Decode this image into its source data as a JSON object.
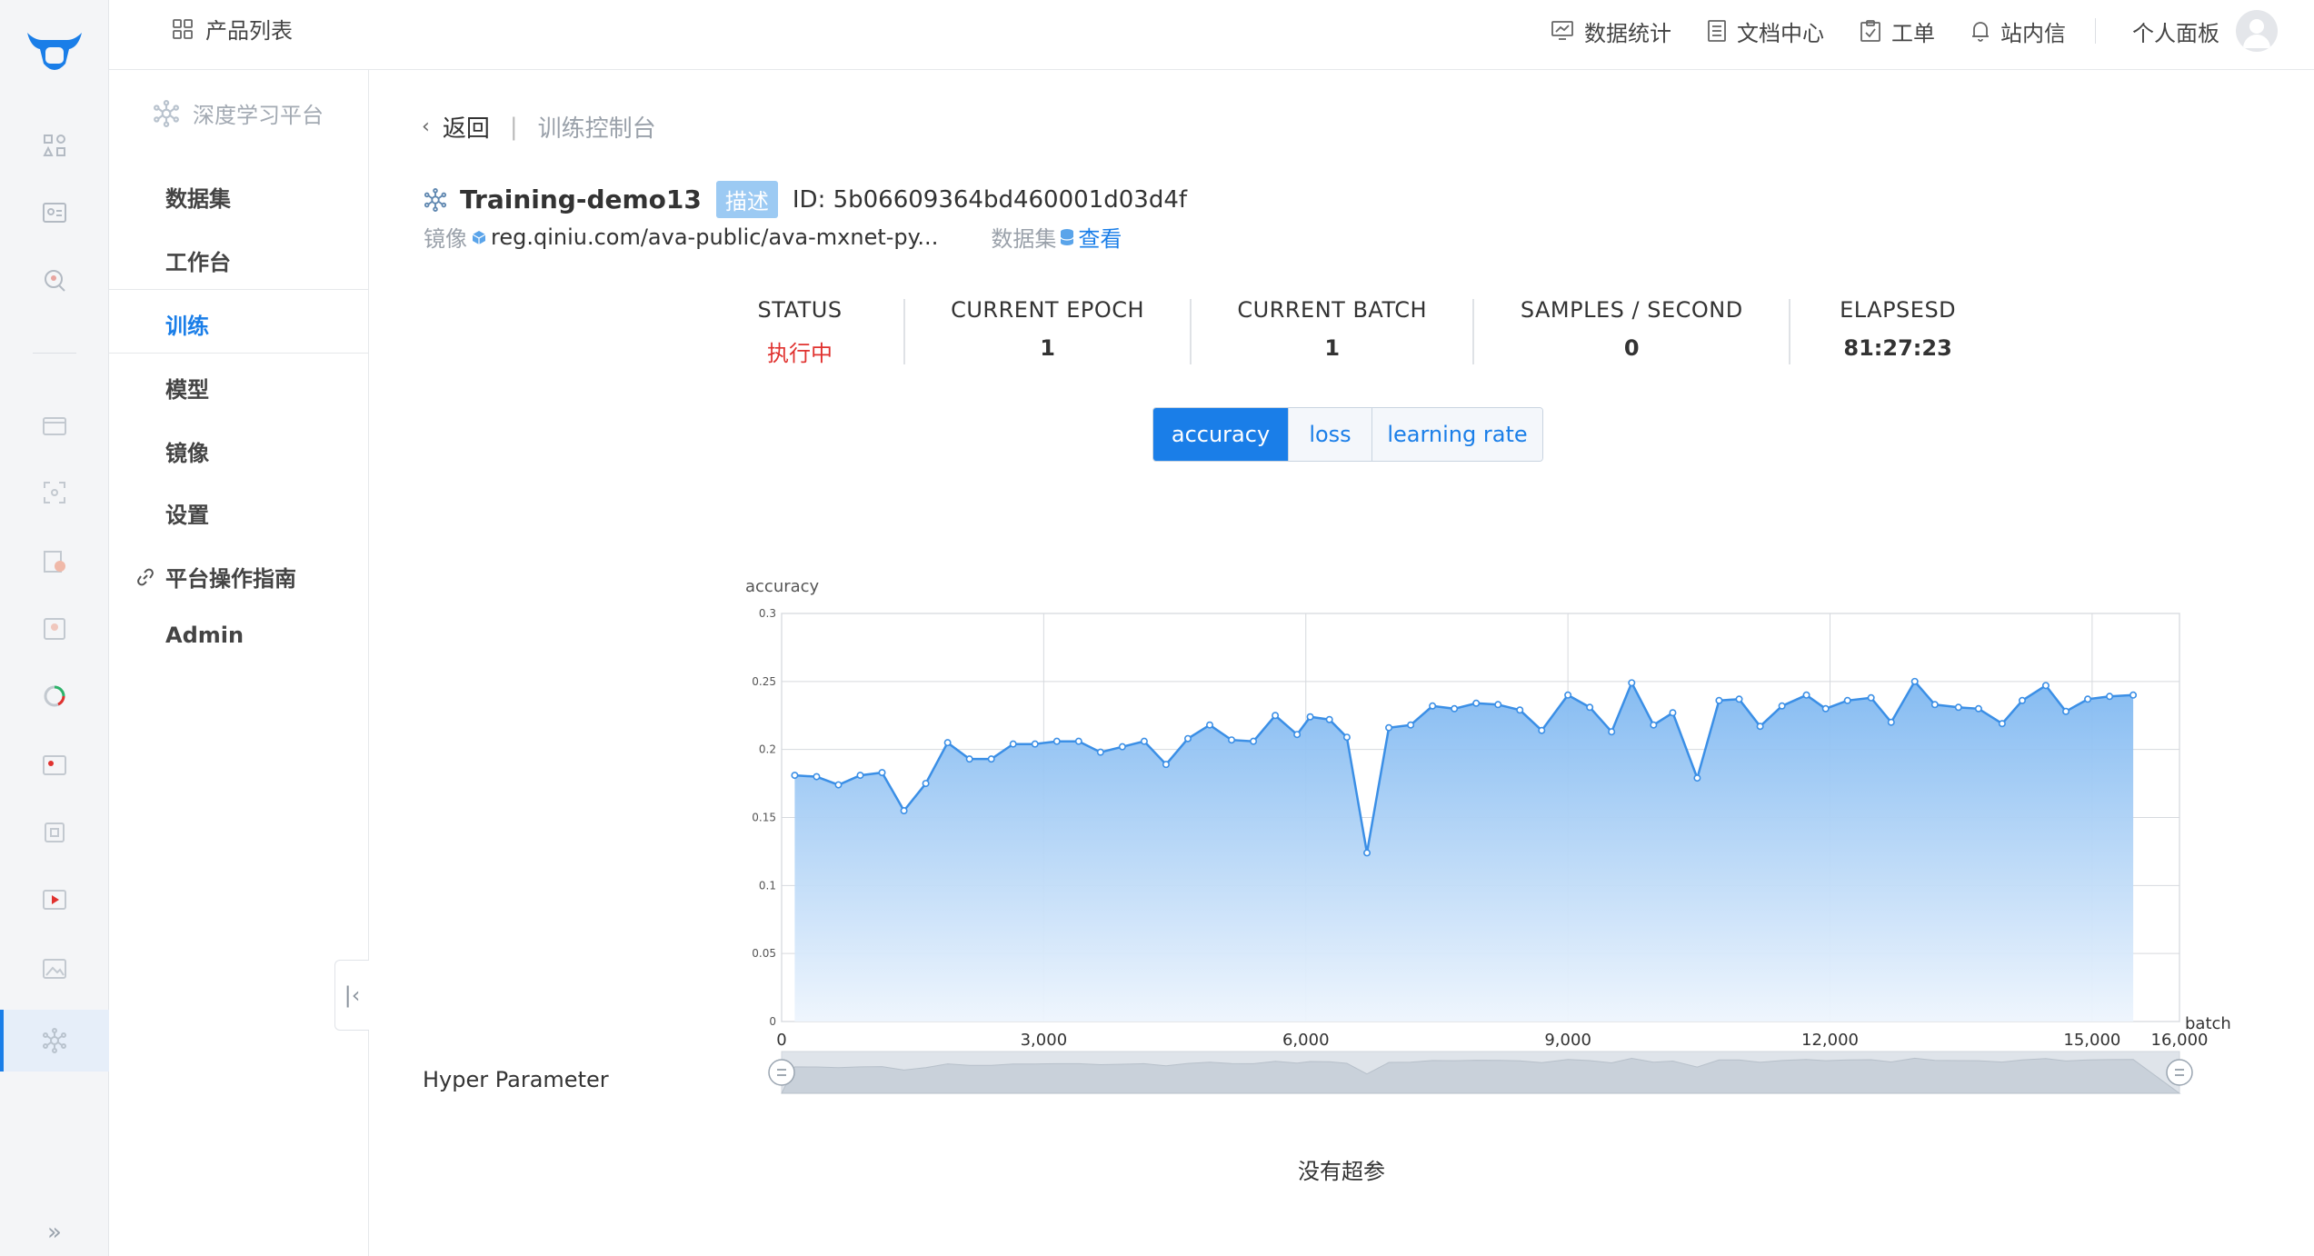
{
  "topbar": {
    "product_list": "产品列表",
    "nav": [
      {
        "label": "数据统计",
        "icon": "chart-icon"
      },
      {
        "label": "文档中心",
        "icon": "document-icon"
      },
      {
        "label": "工单",
        "icon": "ticket-icon"
      },
      {
        "label": "站内信",
        "icon": "bell-icon"
      }
    ],
    "personal_panel": "个人面板"
  },
  "sidebar": {
    "platform": "深度学习平台",
    "items": [
      {
        "label": "数据集"
      },
      {
        "label": "工作台"
      },
      {
        "label": "训练",
        "active": true
      },
      {
        "label": "模型"
      },
      {
        "label": "镜像"
      },
      {
        "label": "设置"
      },
      {
        "label": "平台操作指南"
      },
      {
        "label": "Admin"
      }
    ]
  },
  "breadcrumb": {
    "back": "返回",
    "current": "训练控制台"
  },
  "job": {
    "name": "Training-demo13",
    "tag": "描述",
    "id": "ID: 5b06609364bd460001d03d4f",
    "image_label": "镜像",
    "image_value": "reg.qiniu.com/ava-public/ava-mxnet-py...",
    "dataset_label": "数据集",
    "dataset_link": "查看"
  },
  "stats": [
    {
      "key": "STATUS",
      "value": "执行中",
      "status": true
    },
    {
      "key": "CURRENT EPOCH",
      "value": "1"
    },
    {
      "key": "CURRENT BATCH",
      "value": "1"
    },
    {
      "key": "SAMPLES / SECOND",
      "value": "0"
    },
    {
      "key": "ELAPSESD",
      "value": "81:27:23"
    }
  ],
  "metric_tabs": [
    "accuracy",
    "loss",
    "learning rate"
  ],
  "colors": {
    "accent": "#1a7ee8",
    "status_red": "#e0322f",
    "area_top": "#7fb8f1",
    "area_bottom": "#eef5fd"
  },
  "chart_data": {
    "type": "area",
    "ylabel": "accuracy",
    "xlabel": "batch",
    "xlim": [
      0,
      16000
    ],
    "ylim": [
      0,
      0.3
    ],
    "xticks": [
      0,
      3000,
      6000,
      9000,
      12000,
      15000,
      16000
    ],
    "xtick_labels": [
      "0",
      "3,000",
      "6,000",
      "9,000",
      "12,000",
      "15,000",
      "16,000"
    ],
    "yticks": [
      0,
      0.05,
      0.1,
      0.15,
      0.2,
      0.25,
      0.3
    ],
    "ytick_labels": [
      "0",
      "0.05",
      "0.1",
      "0.15",
      "0.2",
      "0.25",
      "0.3"
    ],
    "grid": true,
    "x": [
      150,
      400,
      650,
      900,
      1150,
      1400,
      1650,
      1900,
      2150,
      2400,
      2650,
      2900,
      3150,
      3400,
      3650,
      3900,
      4150,
      4400,
      4650,
      4900,
      5150,
      5400,
      5650,
      5900,
      6050,
      6270,
      6470,
      6700,
      6950,
      7200,
      7450,
      7700,
      7950,
      8200,
      8450,
      8700,
      9000,
      9250,
      9500,
      9730,
      9980,
      10200,
      10480,
      10730,
      10960,
      11200,
      11450,
      11730,
      11950,
      12200,
      12470,
      12700,
      12970,
      13200,
      13470,
      13700,
      13970,
      14200,
      14470,
      14700,
      14950,
      15200,
      15470
    ],
    "y": [
      0.181,
      0.18,
      0.174,
      0.181,
      0.183,
      0.155,
      0.175,
      0.205,
      0.193,
      0.193,
      0.204,
      0.204,
      0.206,
      0.206,
      0.198,
      0.202,
      0.206,
      0.189,
      0.208,
      0.218,
      0.207,
      0.206,
      0.225,
      0.211,
      0.224,
      0.222,
      0.209,
      0.124,
      0.216,
      0.218,
      0.232,
      0.23,
      0.234,
      0.233,
      0.229,
      0.214,
      0.24,
      0.231,
      0.213,
      0.249,
      0.218,
      0.227,
      0.179,
      0.236,
      0.237,
      0.217,
      0.232,
      0.24,
      0.23,
      0.236,
      0.238,
      0.22,
      0.25,
      0.233,
      0.231,
      0.23,
      0.219,
      0.236,
      0.247,
      0.228,
      0.237,
      0.239,
      0.24
    ]
  },
  "hyper_parameter": {
    "title": "Hyper Parameter",
    "empty": "没有超参"
  }
}
